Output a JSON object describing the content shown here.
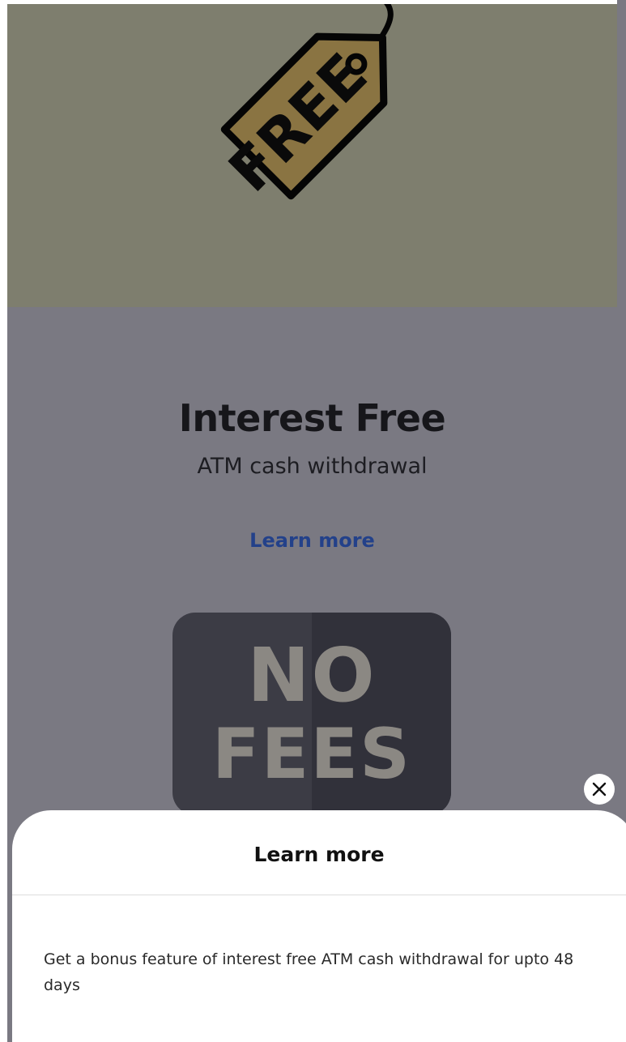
{
  "hero": {
    "tag_text": "FREE",
    "tag_icon": "price-tag-icon",
    "background": "#7e7e6e",
    "tag_color": "#8a7442"
  },
  "feature": {
    "title": "Interest Free",
    "subtitle": "ATM cash withdrawal",
    "link_label": "Learn more",
    "link_color": "#23418a"
  },
  "badge": {
    "line1": "NO",
    "line2": "FEES",
    "icon": "no-fees-icon"
  },
  "sheet": {
    "close_icon": "close-icon",
    "title": "Learn more",
    "body": "Get a bonus feature of interest free ATM cash withdrawal for upto 48 days"
  }
}
